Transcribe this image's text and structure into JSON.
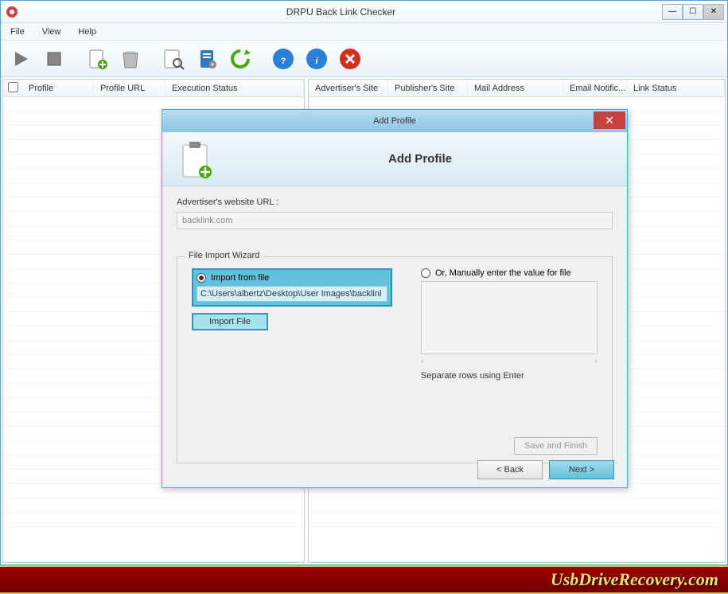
{
  "window": {
    "title": "DRPU Back Link Checker"
  },
  "menu": {
    "file": "File",
    "view": "View",
    "help": "Help"
  },
  "columns_left": {
    "profile": "Profile",
    "profile_url": "Profile URL",
    "exec_status": "Execution Status"
  },
  "columns_right": {
    "adv_site": "Advertiser's Site",
    "pub_site": "Publisher's Site",
    "mail": "Mail Address",
    "email_notif": "Email Notific...",
    "link_status": "Link Status"
  },
  "dialog": {
    "title": "Add Profile",
    "header_title": "Add Profile",
    "url_label": "Advertiser's website URL :",
    "url_value": "backlink.com",
    "legend": "File Import Wizard",
    "radio_import": "Import from file",
    "path_value": "C:\\Users\\albertz\\Desktop\\User Images\\backlinl",
    "import_button": "Import File",
    "radio_manual": "Or, Manually enter the value for file",
    "separate_note": "Separate rows using Enter",
    "save_button": "Save and Finish",
    "back_button": "< Back",
    "next_button": "Next >"
  },
  "brand": "UsbDriveRecovery.com"
}
